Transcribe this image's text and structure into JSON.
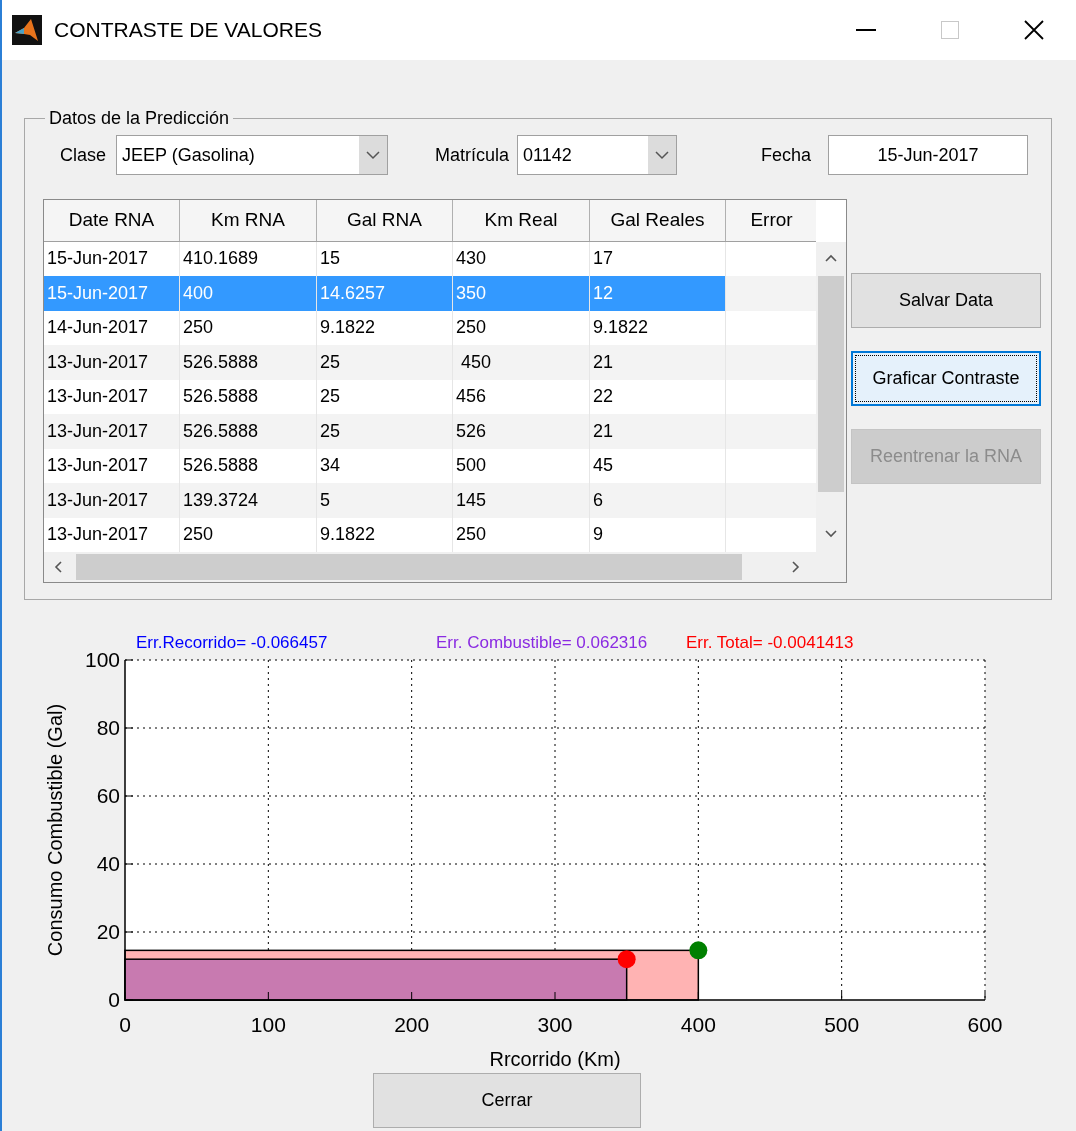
{
  "window": {
    "title": "CONTRASTE DE VALORES"
  },
  "panel": {
    "title": "Datos de la Predicción",
    "clase": {
      "label": "Clase",
      "value": "JEEP (Gasolina)"
    },
    "matricula": {
      "label": "Matrícula",
      "value": "01142"
    },
    "fecha": {
      "label": "Fecha",
      "value": "15-Jun-2017"
    },
    "table": {
      "columns": [
        "Date RNA",
        "Km RNA",
        "Gal RNA",
        "Km Real",
        "Gal Reales",
        "Error"
      ],
      "rows": [
        {
          "cells": [
            "15-Jun-2017",
            "410.1689",
            "15",
            "430",
            "17"
          ],
          "selected": false
        },
        {
          "cells": [
            "15-Jun-2017",
            "400",
            "14.6257",
            "350",
            "12"
          ],
          "selected": true
        },
        {
          "cells": [
            "14-Jun-2017",
            "250",
            "9.1822",
            "250",
            "9.1822"
          ],
          "selected": false
        },
        {
          "cells": [
            "13-Jun-2017",
            "526.5888",
            "25",
            " 450",
            "21"
          ],
          "selected": false
        },
        {
          "cells": [
            "13-Jun-2017",
            "526.5888",
            "25",
            "456",
            "22"
          ],
          "selected": false
        },
        {
          "cells": [
            "13-Jun-2017",
            "526.5888",
            "25",
            "526",
            "21"
          ],
          "selected": false
        },
        {
          "cells": [
            "13-Jun-2017",
            "526.5888",
            "34",
            "500",
            "45"
          ],
          "selected": false
        },
        {
          "cells": [
            "13-Jun-2017",
            "139.3724",
            "5",
            "145",
            "6"
          ],
          "selected": false
        },
        {
          "cells": [
            "13-Jun-2017",
            "250",
            "9.1822",
            "250",
            "9"
          ],
          "selected": false
        }
      ]
    },
    "buttons": [
      {
        "label": "Salvar Data",
        "focused": false,
        "disabled": false
      },
      {
        "label": "Graficar Contraste",
        "focused": true,
        "disabled": false
      },
      {
        "label": "Reentrenar la RNA",
        "focused": false,
        "disabled": true
      }
    ]
  },
  "errors": [
    {
      "text": "Err.Recorrido= -0.066457",
      "color": "#0000ff"
    },
    {
      "text": "Err. Combustible= 0.062316",
      "color": "#8a2be2"
    },
    {
      "text": "Err. Total= -0.0041413",
      "color": "#ff0000"
    }
  ],
  "chart_data": {
    "type": "scatter",
    "xlabel": "Rrcorrido (Km)",
    "ylabel": "Consumo Combustible (Gal)",
    "xlim": [
      0,
      600
    ],
    "ylim": [
      0,
      100
    ],
    "xticks": [
      0,
      100,
      200,
      300,
      400,
      500,
      600
    ],
    "yticks": [
      0,
      20,
      40,
      60,
      80,
      100
    ],
    "series": [
      {
        "color": "#008000",
        "x": [
          400
        ],
        "values": [
          14.6
        ]
      },
      {
        "color": "#ff0000",
        "x": [
          350
        ],
        "values": [
          12
        ]
      }
    ],
    "grid": true
  },
  "close_button": {
    "label": "Cerrar"
  }
}
